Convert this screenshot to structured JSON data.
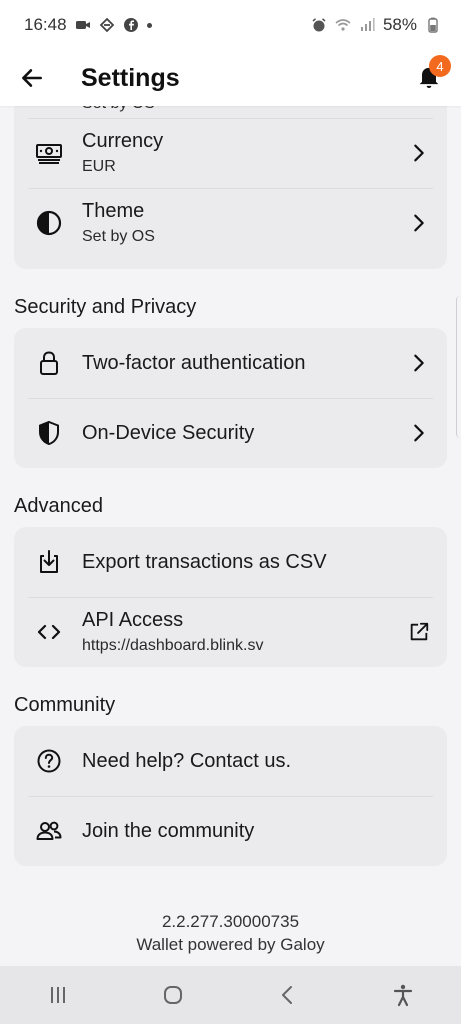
{
  "status_bar": {
    "time": "16:48",
    "battery": "58%",
    "left_icons": [
      "video-icon",
      "link-icon",
      "facebook-icon",
      "dot-icon"
    ],
    "right_icons": [
      "alarm-icon",
      "wifi-icon",
      "signal-icon",
      "battery-icon"
    ]
  },
  "header": {
    "title": "Settings",
    "notification_count": "4"
  },
  "preferences": {
    "partial_row_sub": "Set by OS",
    "items": [
      {
        "label": "Currency",
        "value": "EUR",
        "icon": "banknote-icon"
      },
      {
        "label": "Theme",
        "value": "Set by OS",
        "icon": "half-circle-icon"
      }
    ]
  },
  "security": {
    "title": "Security and Privacy",
    "items": [
      {
        "label": "Two-factor authentication",
        "icon": "lock-icon"
      },
      {
        "label": "On-Device Security",
        "icon": "shield-icon"
      }
    ]
  },
  "advanced": {
    "title": "Advanced",
    "items": [
      {
        "label": "Export transactions as CSV",
        "icon": "download-icon"
      },
      {
        "label": "API Access",
        "value": "https://dashboard.blink.sv",
        "icon": "code-icon"
      }
    ]
  },
  "community": {
    "title": "Community",
    "items": [
      {
        "label": "Need help? Contact us.",
        "icon": "help-icon"
      },
      {
        "label": "Join the community",
        "icon": "people-icon"
      }
    ]
  },
  "footer": {
    "version": "2.2.277.30000735",
    "powered_by": "Wallet powered by Galoy"
  },
  "colors": {
    "badge": "#f36a1f",
    "card": "#ebebee",
    "background": "#f4f4f6"
  }
}
